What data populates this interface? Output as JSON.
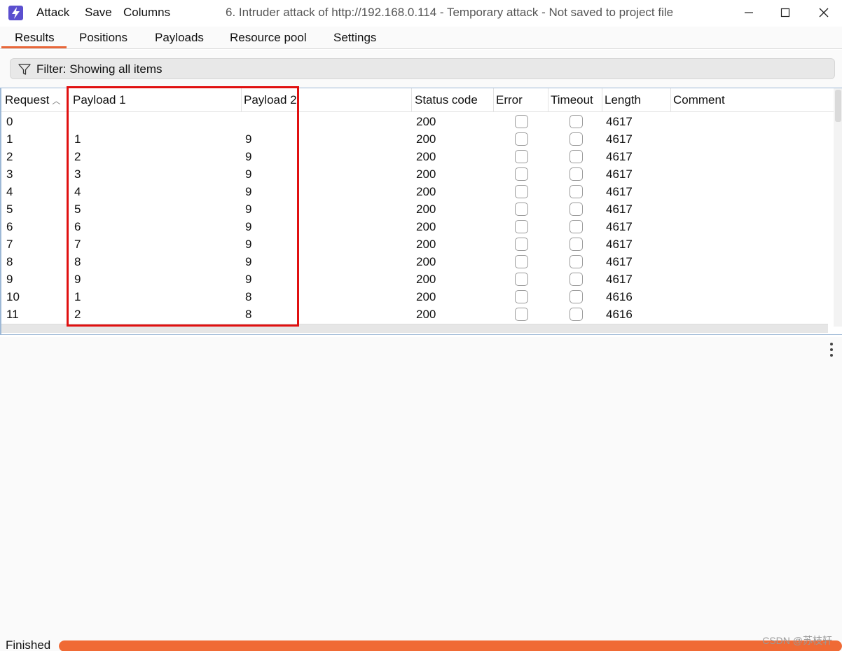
{
  "titlebar": {
    "menu": [
      "Attack",
      "Save",
      "Columns"
    ],
    "title": "6. Intruder attack of http://192.168.0.114 - Temporary attack - Not saved to project file"
  },
  "tabs": [
    "Results",
    "Positions",
    "Payloads",
    "Resource pool",
    "Settings"
  ],
  "filter": {
    "text": "Filter: Showing all items"
  },
  "table": {
    "columns": [
      "Request",
      "Payload 1",
      "Payload 2",
      "Status code",
      "Error",
      "Timeout",
      "Length",
      "Comment"
    ],
    "rows": [
      {
        "request": "0",
        "payload1": "",
        "payload2": "",
        "status": "200",
        "length": "4617"
      },
      {
        "request": "1",
        "payload1": "1",
        "payload2": "9",
        "status": "200",
        "length": "4617"
      },
      {
        "request": "2",
        "payload1": "2",
        "payload2": "9",
        "status": "200",
        "length": "4617"
      },
      {
        "request": "3",
        "payload1": "3",
        "payload2": "9",
        "status": "200",
        "length": "4617"
      },
      {
        "request": "4",
        "payload1": "4",
        "payload2": "9",
        "status": "200",
        "length": "4617"
      },
      {
        "request": "5",
        "payload1": "5",
        "payload2": "9",
        "status": "200",
        "length": "4617"
      },
      {
        "request": "6",
        "payload1": "6",
        "payload2": "9",
        "status": "200",
        "length": "4617"
      },
      {
        "request": "7",
        "payload1": "7",
        "payload2": "9",
        "status": "200",
        "length": "4617"
      },
      {
        "request": "8",
        "payload1": "8",
        "payload2": "9",
        "status": "200",
        "length": "4617"
      },
      {
        "request": "9",
        "payload1": "9",
        "payload2": "9",
        "status": "200",
        "length": "4617"
      },
      {
        "request": "10",
        "payload1": "1",
        "payload2": "8",
        "status": "200",
        "length": "4616"
      },
      {
        "request": "11",
        "payload1": "2",
        "payload2": "8",
        "status": "200",
        "length": "4616"
      }
    ]
  },
  "status": {
    "text": "Finished",
    "progress_percent": 100
  },
  "watermark": "CSDN @苏枝轩",
  "colors": {
    "accent": "#f06a35",
    "highlight": "#e01010",
    "app_icon": "#5b4fcf"
  }
}
